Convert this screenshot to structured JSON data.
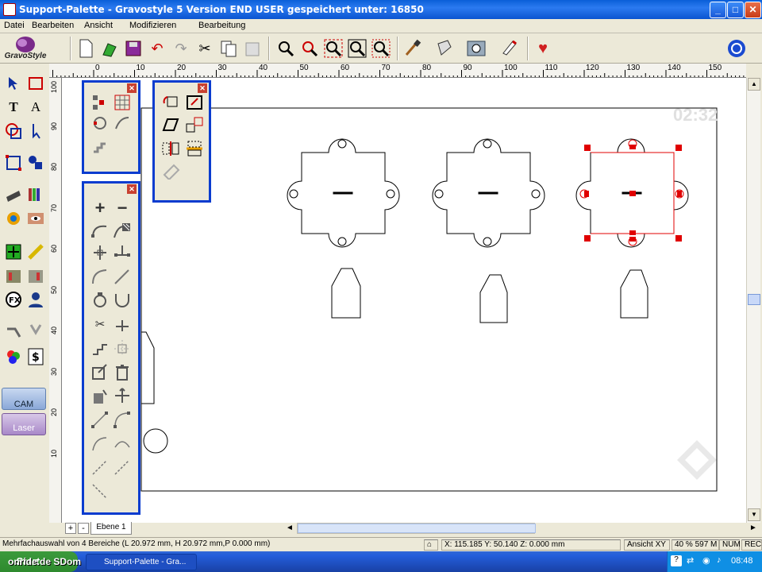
{
  "window": {
    "title": "Support-Palette - Gravostyle 5  Version END USER gespeichert unter: 16850",
    "minimize": "_",
    "maximize": "□",
    "close": "✕"
  },
  "menu": [
    "Datei",
    "Bearbeiten",
    "Ansicht",
    "Modifizieren",
    "Bearbeitung"
  ],
  "logo_text": "GravoStyle",
  "ruler": {
    "h_labels": [
      "0",
      "10",
      "20",
      "30",
      "40",
      "50",
      "60",
      "70",
      "80",
      "90",
      "100",
      "110",
      "120",
      "130",
      "140",
      "150",
      "160"
    ],
    "v_labels": [
      "100",
      "90",
      "80",
      "70",
      "60",
      "50",
      "40",
      "30",
      "20",
      "10"
    ]
  },
  "canvas": {
    "timer": "02:32"
  },
  "left_panel": {
    "cam_label": "CAM",
    "laser_label": "Laser"
  },
  "layer_bar": {
    "add": "+",
    "remove": "-",
    "layer_tab": "Ebene 1"
  },
  "status": {
    "selection": "Mehrfachauswahl von 4 Bereiche (L 20.972 mm, H 20.972 mm,P 0.000 mm)",
    "coords": "X: 115.185   Y: 50.140   Z: 0.000 mm",
    "view": "Ansicht XY",
    "zoom": "40 % 597 M",
    "num": "NUM",
    "rec": "REC"
  },
  "taskbar": {
    "start": "Start",
    "task": "Support-Palette - Gra...",
    "clock": "08:48",
    "watermark": "onride.de   SDom"
  },
  "colors": {
    "titlebar": "#0a5fd8",
    "palette_border": "#0a3ccf",
    "selection_red": "#e00000"
  }
}
